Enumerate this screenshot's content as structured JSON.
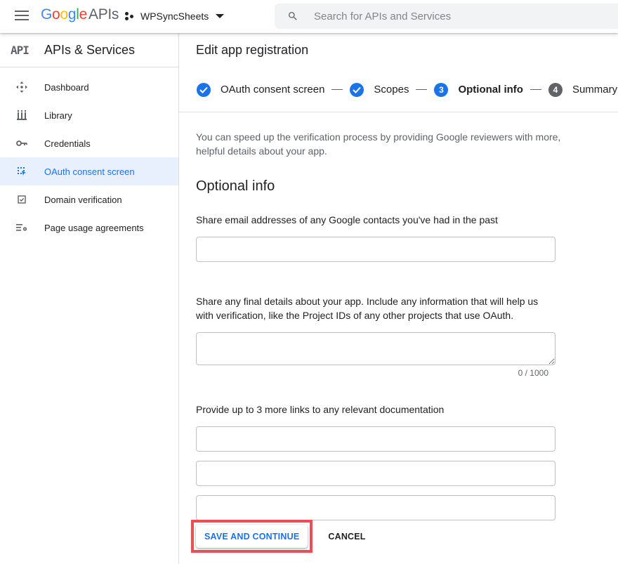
{
  "header": {
    "logo": {
      "g1": "G",
      "o1": "o",
      "o2": "o",
      "g2": "g",
      "l": "l",
      "e": "e",
      "apis": "APIs"
    },
    "project_name": "WPSyncSheets",
    "search_placeholder": "Search for APIs and Services"
  },
  "sidebar": {
    "mark": "API",
    "title": "APIs & Services",
    "items": [
      {
        "label": "Dashboard",
        "icon": "dashboard-icon",
        "active": false
      },
      {
        "label": "Library",
        "icon": "library-icon",
        "active": false
      },
      {
        "label": "Credentials",
        "icon": "key-icon",
        "active": false
      },
      {
        "label": "OAuth consent screen",
        "icon": "consent-icon",
        "active": true
      },
      {
        "label": "Domain verification",
        "icon": "checkbox-icon",
        "active": false
      },
      {
        "label": "Page usage agreements",
        "icon": "settings-list-icon",
        "active": false
      }
    ]
  },
  "main": {
    "title": "Edit app registration",
    "steps": [
      {
        "number": "",
        "label": "OAuth consent screen",
        "state": "done"
      },
      {
        "number": "",
        "label": "Scopes",
        "state": "done"
      },
      {
        "number": "3",
        "label": "Optional info",
        "state": "current"
      },
      {
        "number": "4",
        "label": "Summary",
        "state": "pending"
      }
    ],
    "intro": "You can speed up the verification process by providing Google reviewers with more, helpful details about your app.",
    "section_title": "Optional info",
    "fields": {
      "contacts_label": "Share email addresses of any Google contacts you've had in the past",
      "contacts_value": "",
      "details_label": "Share any final details about your app. Include any information that will help us with verification, like the Project IDs of any other projects that use OAuth.",
      "details_value": "",
      "details_counter": "0 / 1000",
      "links_label": "Provide up to 3 more links to any relevant documentation",
      "link1_value": "",
      "link2_value": "",
      "link3_value": ""
    },
    "actions": {
      "save_label": "SAVE AND CONTINUE",
      "cancel_label": "CANCEL"
    }
  },
  "colors": {
    "accent": "#1a73e8",
    "active_bg": "#e8f0fe",
    "highlight_border": "#ea4f54"
  }
}
